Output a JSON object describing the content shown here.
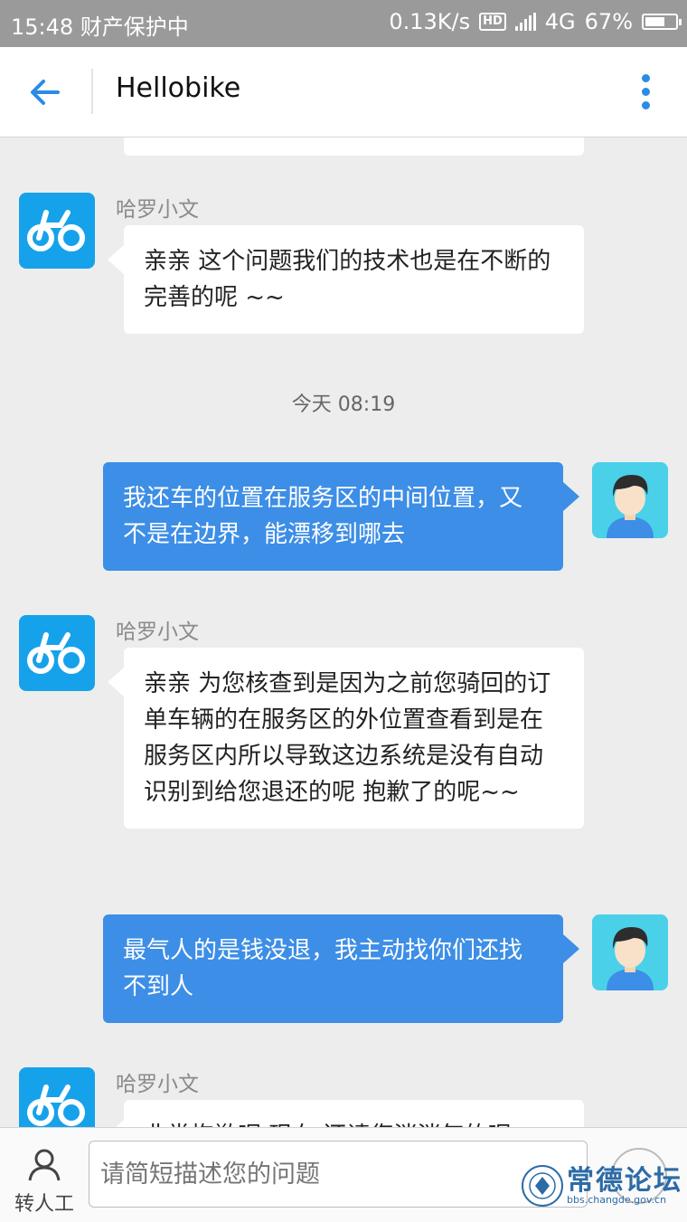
{
  "status_bar": {
    "time": "15:48",
    "notice": "财产保护中",
    "speed": "0.13K/s",
    "hd": "HD",
    "network": "4G",
    "battery": "67%",
    "battery_level": 0.67
  },
  "header": {
    "title": "Hellobike",
    "back_icon": "back-arrow-icon",
    "more_icon": "more-vertical-icon",
    "accent_color": "#2b8be6"
  },
  "chat": {
    "bot_name_1": "哈罗小文",
    "msg_1": "亲亲 这个问题我们的技术也是在不断的完善的呢 ~~",
    "timestamp": "今天 08:19",
    "msg_2": "我还车的位置在服务区的中间位置，又不是在边界，能漂移到哪去",
    "bot_name_2": "哈罗小文",
    "msg_3": "亲亲 为您核查到是因为之前您骑回的订单车辆的在服务区的外位置查看到是在服务区内所以导致这边系统是没有自动识别到给您退还的呢 抱歉了的呢~~",
    "msg_4": "最气人的是钱没退，我主动找你们还找不到人",
    "bot_name_3": "哈罗小文",
    "msg_5_partial": "非常抱歉呢 现在 还请您消消气的呢"
  },
  "input": {
    "agent_label": "转人工",
    "placeholder": "请简短描述您的问题"
  },
  "watermark": {
    "title": "常德论坛",
    "url": "bbs.changde.gov.cn"
  }
}
